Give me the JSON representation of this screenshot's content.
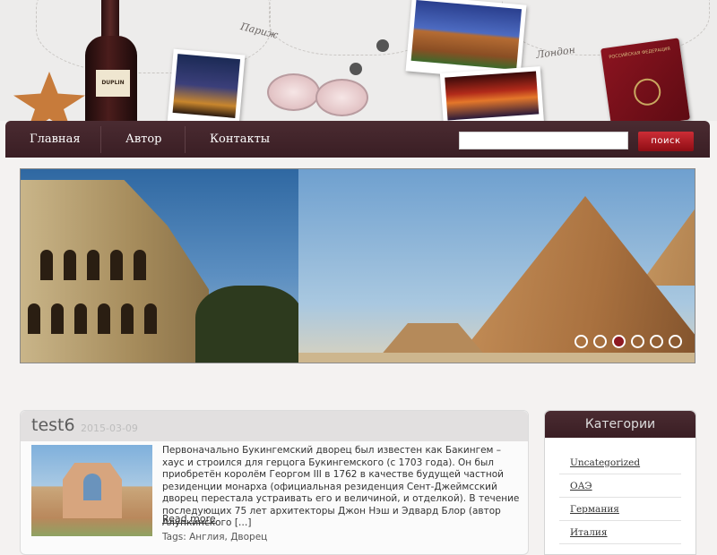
{
  "header": {
    "city1": "Париж",
    "city2": "Лондон",
    "bottle_label": "DUPLIN",
    "passport_text": "РОССИЙСКАЯ ФЕДЕРАЦИЯ"
  },
  "nav": {
    "items": [
      {
        "label": "Главная"
      },
      {
        "label": "Автор"
      },
      {
        "label": "Контакты"
      }
    ],
    "search_placeholder": "",
    "search_button": "поиск"
  },
  "slider": {
    "dots": 6,
    "active_index": 2
  },
  "post": {
    "title": "test6",
    "date": "2015-03-09",
    "excerpt": "Первоначально Букингемский дворец был известен как Бакингем – хаус и строился для герцога Букингемского (с 1703 года). Он был приобретён королём Георгом III в 1762 в качестве будущей частной резиденции монарха (официальная резиденция Сент-Джеймсский дворец перестала устраивать его и величиной, и отделкой). В течение последующих 75 лет архитекторы Джон Нэш и Эдвард Блор (автор Алупкинского […]",
    "read_more": "Read more",
    "tags": "Tags: Англия, Дворец"
  },
  "sidebar": {
    "title": "Категории",
    "categories": [
      {
        "label": "Uncategorized"
      },
      {
        "label": "ОАЭ"
      },
      {
        "label": "Германия"
      },
      {
        "label": "Италия"
      }
    ]
  },
  "colors": {
    "nav_bg": "#3f2329",
    "search_btn": "#b01c24",
    "active_dot": "#8e1a22"
  }
}
